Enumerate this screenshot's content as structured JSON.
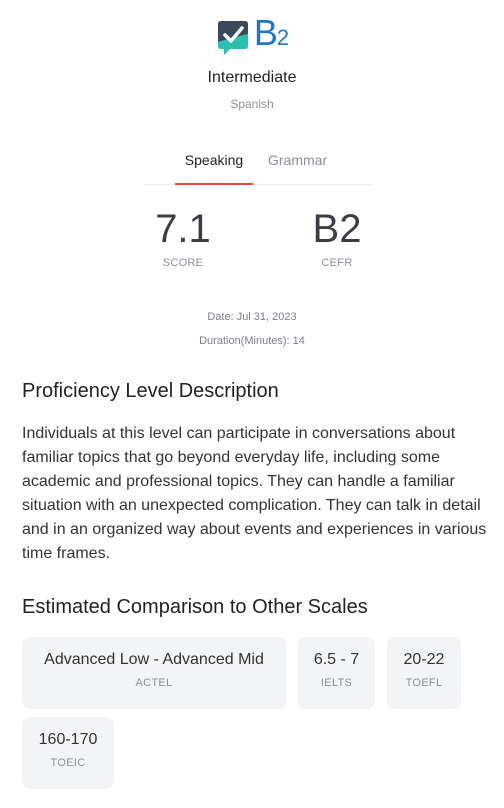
{
  "header": {
    "level": "B",
    "level_sub": "2",
    "level_name": "Intermediate",
    "language": "Spanish",
    "logo_icon": "speech-check-icon",
    "logo_colors": {
      "top": "#3a4a5c",
      "bottom": "#2bbfb0",
      "check": "#ffffff",
      "text": "#1f77c2"
    }
  },
  "tabs": [
    {
      "label": "Speaking",
      "active": true
    },
    {
      "label": "Grammar",
      "active": false
    }
  ],
  "scores": {
    "score": {
      "value": "7.1",
      "label": "SCORE"
    },
    "cefr": {
      "value": "B2",
      "label": "CEFR"
    }
  },
  "meta": {
    "date": "Date: Jul 31, 2023",
    "duration": "Duration(Minutes): 14"
  },
  "description": {
    "title": "Proficiency Level Description",
    "text": "Individuals at this level can participate in conversations about familiar topics that go beyond everyday life, including some academic and professional topics. They can handle a familiar situation with an unexpected complication. They can talk in detail and in an organized way about events and experiences in various time frames."
  },
  "comparison": {
    "title": "Estimated Comparison to Other Scales",
    "cards": [
      {
        "value": "Advanced Low - Advanced Mid",
        "scale": "ACTEL"
      },
      {
        "value": "6.5 - 7",
        "scale": "IELTS"
      },
      {
        "value": "20-22",
        "scale": "TOEFL"
      },
      {
        "value": "160-170",
        "scale": "TOEIC"
      }
    ]
  },
  "accent_color": "#e74c3c"
}
